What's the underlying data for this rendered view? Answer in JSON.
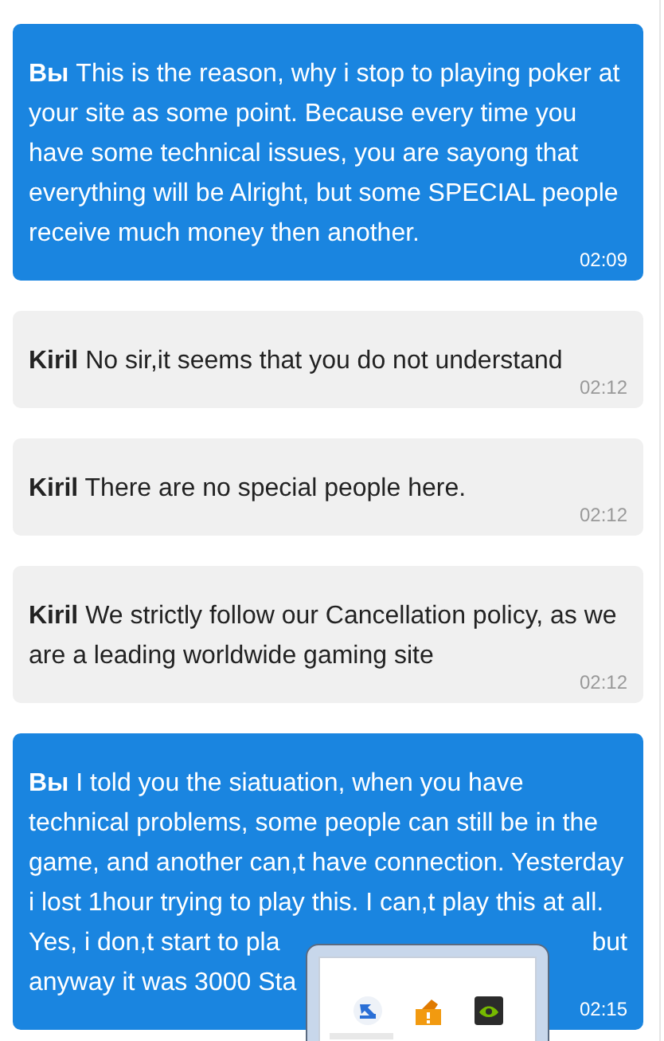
{
  "messages": [
    {
      "kind": "sent",
      "text": "**Вы** This is the reason, why i stop to playing poker at your site as some point. Because every time you have some technical issues, you are sayong that everything will be Alright, but some SPECIAL people receive much money then another.",
      "time": "02:09"
    },
    {
      "kind": "received",
      "text": "**Kiril** No sir,it seems that you do not understand",
      "time": "02:12"
    },
    {
      "kind": "received",
      "text": "**Kiril** There are no special people here.",
      "time": "02:12"
    },
    {
      "kind": "received",
      "text": "**Kiril** We strictly follow our Cancellation policy, as we are a leading worldwide gaming site",
      "time": "02:12"
    },
    {
      "kind": "sent",
      "lines": [
        [
          "**Вы** I told you the siatuation, when you have"
        ],
        [
          "technical problems, some people can still be in the"
        ],
        [
          "game, and another can,t have connection. Yesterday"
        ],
        [
          "i lost 1hour trying to play this. I can,t play this at all."
        ],
        [
          "Yes, i don,t start to pla",
          "but"
        ],
        [
          "anyway it was 3000 Sta"
        ]
      ],
      "time": "02:15"
    }
  ]
}
